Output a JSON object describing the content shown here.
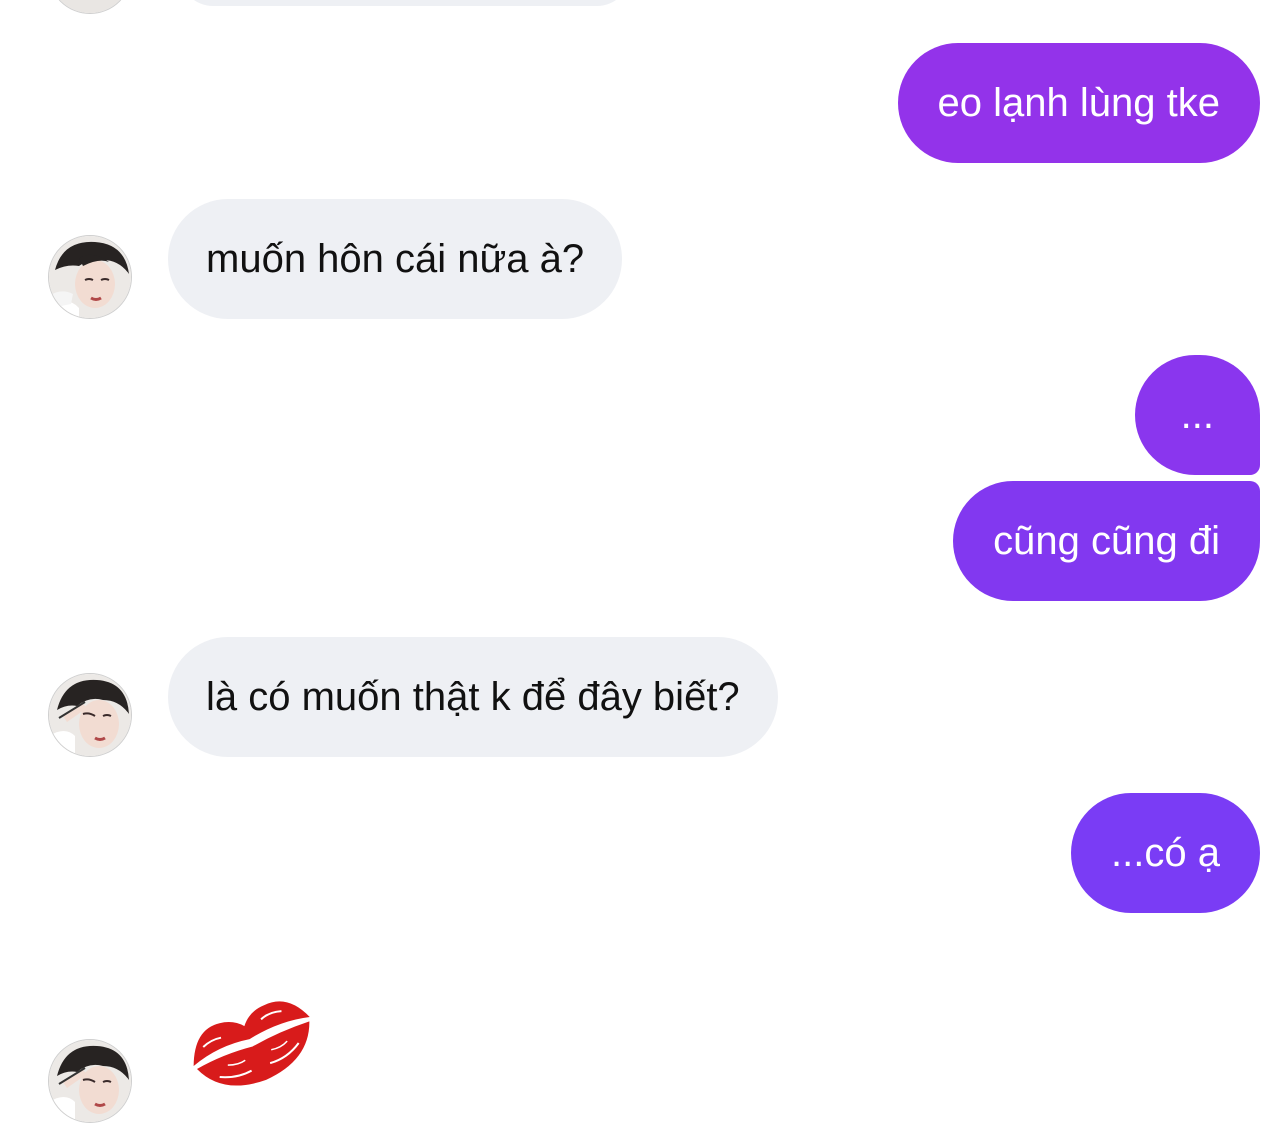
{
  "colors": {
    "outgoing_top": "#9333ea",
    "outgoing_mid": "#8238f0",
    "outgoing_bottom": "#7a3cf5",
    "incoming_bg": "#eef0f4",
    "lips": "#d81b1b"
  },
  "messages": [
    {
      "sender": "me",
      "text": "eo lạnh lùng tke"
    },
    {
      "sender": "them",
      "text": "muốn hôn cái nữa à?",
      "avatar": "user-avatar-photo"
    },
    {
      "sender": "me",
      "text": "..."
    },
    {
      "sender": "me",
      "text": "cũng cũng đi"
    },
    {
      "sender": "them",
      "text": "là có muốn thật k để đây biết?",
      "avatar": "user-avatar-photo"
    },
    {
      "sender": "me",
      "text": "...có ạ"
    },
    {
      "sender": "them",
      "emoji": "kiss-mark-icon",
      "avatar": "user-avatar-photo"
    }
  ]
}
